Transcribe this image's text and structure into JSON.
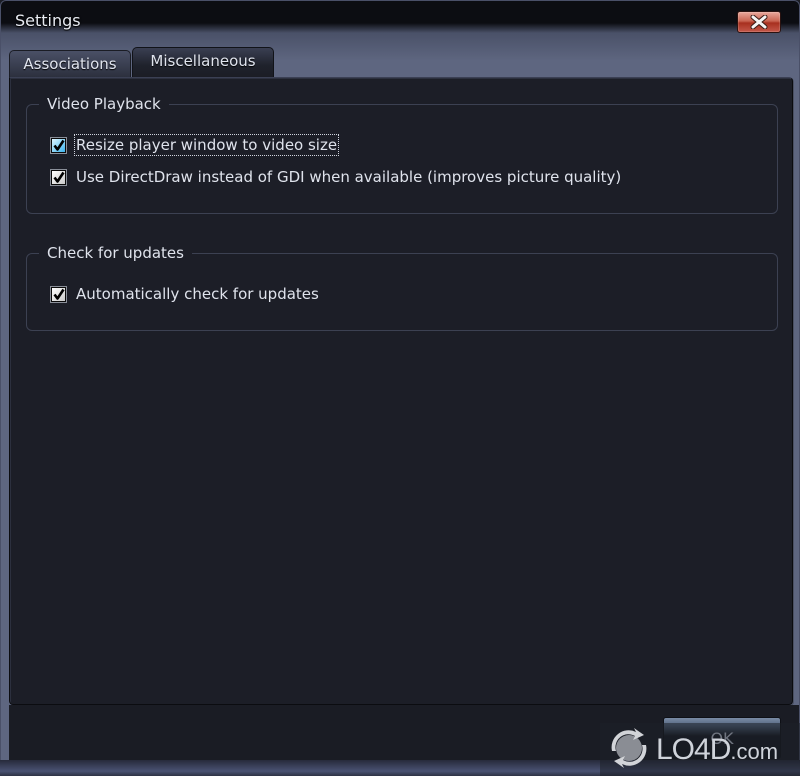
{
  "window": {
    "title": "Settings",
    "close_label": "Close"
  },
  "tabs": [
    {
      "label": "Associations",
      "active": false
    },
    {
      "label": "Miscellaneous",
      "active": true
    }
  ],
  "groups": {
    "video_playback": {
      "title": "Video Playback",
      "options": [
        {
          "label": "Resize player window to video size",
          "checked": true,
          "focused": true
        },
        {
          "label": "Use DirectDraw instead of GDI when available (improves picture quality)",
          "checked": true,
          "focused": false
        }
      ]
    },
    "updates": {
      "title": "Check for updates",
      "options": [
        {
          "label": "Automatically check for updates",
          "checked": true,
          "focused": false
        }
      ]
    }
  },
  "footer": {
    "ok_label": "OK"
  },
  "watermark": {
    "brand": "LO4D",
    "suffix": ".com"
  },
  "colors": {
    "panel_bg": "#1c1e27",
    "text": "#dfe3ec",
    "close_red": "#c86452",
    "focus_blue": "#3ab3ee"
  }
}
